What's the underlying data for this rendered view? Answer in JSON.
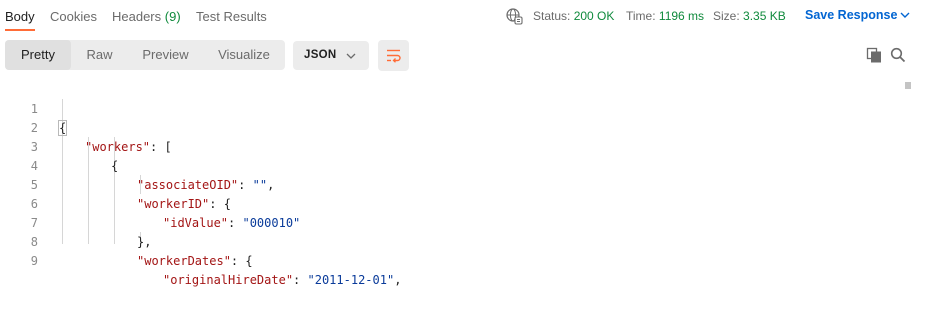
{
  "tabs": [
    {
      "label": "Body"
    },
    {
      "label": "Cookies"
    },
    {
      "label": "Headers",
      "count": "(9)"
    },
    {
      "label": "Test Results"
    }
  ],
  "status": {
    "status_label": "Status:",
    "status_value": "200 OK",
    "time_label": "Time:",
    "time_value": "1196 ms",
    "size_label": "Size:",
    "size_value": "3.35 KB"
  },
  "save_response": {
    "label": "Save Response"
  },
  "view_modes": [
    {
      "label": "Pretty",
      "active": true
    },
    {
      "label": "Raw"
    },
    {
      "label": "Preview"
    },
    {
      "label": "Visualize"
    }
  ],
  "format": {
    "selected": "JSON"
  },
  "icons": {
    "network": "globe-network-icon",
    "chevron": "chevron-down-icon",
    "wrap": "wrap-lines-icon",
    "copy": "copy-icon",
    "search": "search-icon"
  },
  "colors": {
    "accent": "#ff6c37",
    "status_ok": "#0f8a3c",
    "link": "#0265d2",
    "json_key": "#a31515",
    "json_string": "#0a3b9a"
  },
  "code_lines": [
    {
      "n": "1",
      "text": "{"
    },
    {
      "n": "2",
      "key": "\"workers\"",
      "rest": ": ["
    },
    {
      "n": "3",
      "text": "{"
    },
    {
      "n": "4",
      "key": "\"associateOID\"",
      "rest": ": ",
      "str": "\"\"",
      "tail": ","
    },
    {
      "n": "5",
      "key": "\"workerID\"",
      "rest": ": {"
    },
    {
      "n": "6",
      "key": "\"idValue\"",
      "rest": ": ",
      "str": "\"000010\""
    },
    {
      "n": "7",
      "text": "},"
    },
    {
      "n": "8",
      "key": "\"workerDates\"",
      "rest": ": {"
    },
    {
      "n": "9",
      "key": "\"originalHireDate\"",
      "rest": ": ",
      "str": "\"2011-12-01\"",
      "tail": ","
    }
  ]
}
